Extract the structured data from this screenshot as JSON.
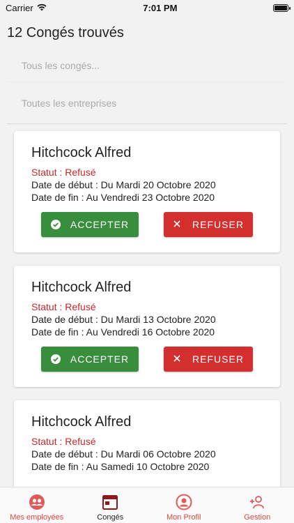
{
  "status_bar": {
    "carrier": "Carrier",
    "time": "7:01 PM"
  },
  "header": {
    "title": "12 Congés trouvés"
  },
  "filters": {
    "conges_placeholder": "Tous les congés...",
    "entreprises_placeholder": "Toutes les entreprises"
  },
  "cards": [
    {
      "name": "Hitchcock Alfred",
      "status": "Statut : Refusé",
      "start": "Date de début : Du Mardi 20 Octobre 2020",
      "end": "Date de fin : Au Vendredi 23 Octobre 2020",
      "accept_label": "ACCEPTER",
      "refuse_label": "REFUSER"
    },
    {
      "name": "Hitchcock Alfred",
      "status": "Statut : Refusé",
      "start": "Date de début : Du Mardi 13 Octobre 2020",
      "end": "Date de fin : Au Vendredi 16 Octobre 2020",
      "accept_label": "ACCEPTER",
      "refuse_label": "REFUSER"
    },
    {
      "name": "Hitchcock Alfred",
      "status": "Statut : Refusé",
      "start": "Date de début : Du Mardi 06 Octobre 2020",
      "end": "Date de fin : Au Samedi 10 Octobre 2020"
    }
  ],
  "tabs": [
    {
      "label": "Mes employées",
      "icon": "group-icon"
    },
    {
      "label": "Congés",
      "icon": "calendar-icon"
    },
    {
      "label": "Mon Profil",
      "icon": "profile-icon"
    },
    {
      "label": "Gestion",
      "icon": "add-person-icon"
    }
  ],
  "colors": {
    "accent": "#d32f2f",
    "accept": "#388e3c",
    "status_refused": "#c62828",
    "background": "#f2f2f2"
  }
}
